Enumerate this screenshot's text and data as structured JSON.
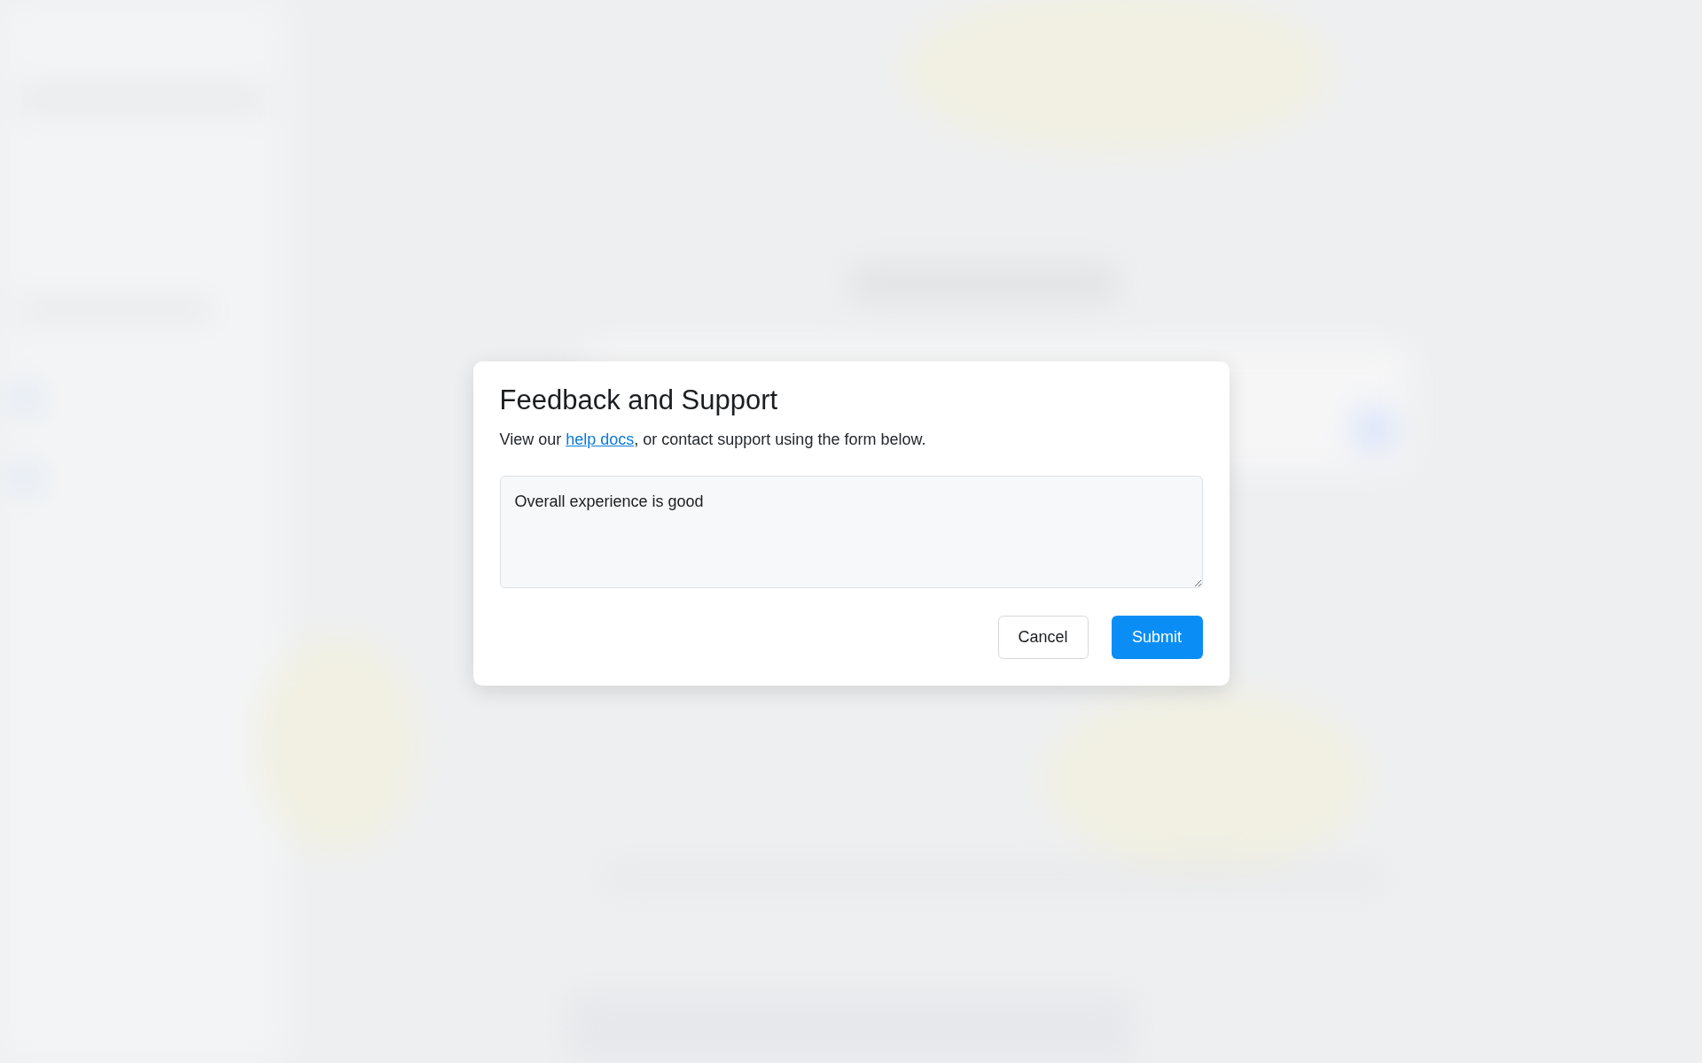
{
  "dialog": {
    "title": "Feedback and Support",
    "description": {
      "before": "View our ",
      "link": "help docs",
      "after": ", or contact support using the form below."
    },
    "message": {
      "value": "Overall experience is good"
    },
    "buttons": [
      {
        "label": "Cancel",
        "kind": "secondary"
      },
      {
        "label": "Submit",
        "kind": "primary"
      }
    ]
  }
}
